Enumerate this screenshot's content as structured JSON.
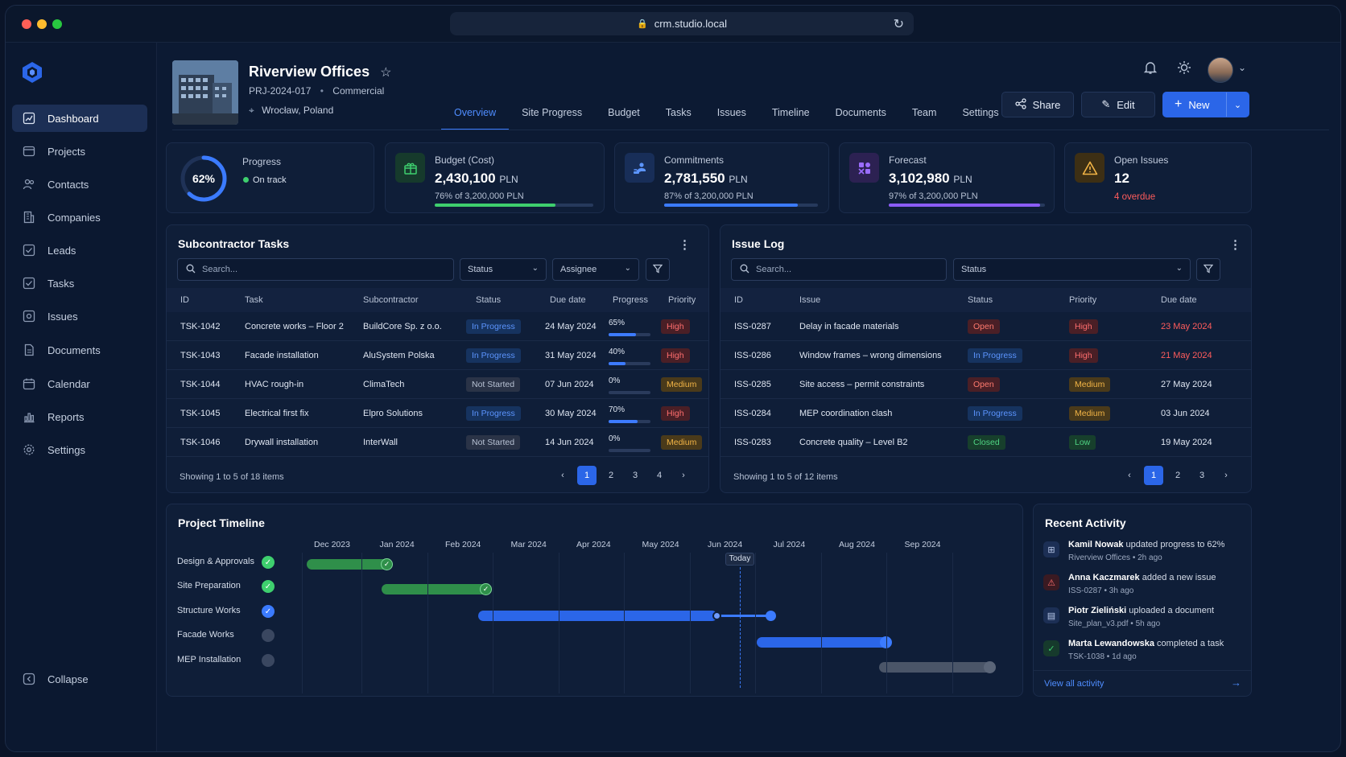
{
  "browser": {
    "url": "crm.studio.local"
  },
  "sidebar": {
    "items": [
      {
        "label": "Dashboard"
      },
      {
        "label": "Projects"
      },
      {
        "label": "Contacts"
      },
      {
        "label": "Companies"
      },
      {
        "label": "Leads"
      },
      {
        "label": "Tasks"
      },
      {
        "label": "Issues"
      },
      {
        "label": "Documents"
      },
      {
        "label": "Calendar"
      },
      {
        "label": "Reports"
      },
      {
        "label": "Settings"
      }
    ],
    "collapse_label": "Collapse"
  },
  "project": {
    "title": "Riverview Offices",
    "code": "PRJ-2024-017",
    "type": "Commercial",
    "location": "Wrocław, Poland"
  },
  "tabs": [
    "Overview",
    "Site Progress",
    "Budget",
    "Tasks",
    "Issues",
    "Timeline",
    "Documents",
    "Team",
    "Settings"
  ],
  "actions": {
    "share": "Share",
    "edit": "Edit",
    "new": "New"
  },
  "kpis": {
    "progress": {
      "label": "Progress",
      "value": "62%",
      "percent": 62,
      "status": "On track"
    },
    "budget": {
      "label": "Budget (Cost)",
      "value": "2,430,100",
      "unit": "PLN",
      "sub": "76% of 3,200,000 PLN",
      "percent": 76,
      "color": "#3ecf6e"
    },
    "commitments": {
      "label": "Commitments",
      "value": "2,781,550",
      "unit": "PLN",
      "sub": "87% of 3,200,000 PLN",
      "percent": 87,
      "color": "#3b7bff"
    },
    "forecast": {
      "label": "Forecast",
      "value": "3,102,980",
      "unit": "PLN",
      "sub": "97% of 3,200,000 PLN",
      "percent": 97,
      "color": "#8b5cf6"
    },
    "issues": {
      "label": "Open Issues",
      "value": "12",
      "sub": "4 overdue"
    }
  },
  "subcontractor_tasks": {
    "title": "Subcontractor Tasks",
    "search_placeholder": "Search...",
    "filters": [
      "Status",
      "Assignee"
    ],
    "columns": [
      "ID",
      "Task",
      "Subcontractor",
      "Status",
      "Due date",
      "Progress",
      "Priority"
    ],
    "rows": [
      {
        "id": "TSK-1042",
        "task": "Concrete works – Floor 2",
        "sub": "BuildCore Sp. z o.o.",
        "status": "In Progress",
        "due": "24 May 2024",
        "progress": "65%",
        "pct": 65,
        "priority": "High"
      },
      {
        "id": "TSK-1043",
        "task": "Facade installation",
        "sub": "AluSystem Polska",
        "status": "In Progress",
        "due": "31 May 2024",
        "progress": "40%",
        "pct": 40,
        "priority": "High"
      },
      {
        "id": "TSK-1044",
        "task": "HVAC rough-in",
        "sub": "ClimaTech",
        "status": "Not Started",
        "due": "07 Jun 2024",
        "progress": "0%",
        "pct": 0,
        "priority": "Medium"
      },
      {
        "id": "TSK-1045",
        "task": "Electrical first fix",
        "sub": "Elpro Solutions",
        "status": "In Progress",
        "due": "30 May 2024",
        "progress": "70%",
        "pct": 70,
        "priority": "High"
      },
      {
        "id": "TSK-1046",
        "task": "Drywall installation",
        "sub": "InterWall",
        "status": "Not Started",
        "due": "14 Jun 2024",
        "progress": "0%",
        "pct": 0,
        "priority": "Medium"
      }
    ],
    "footer": "Showing 1 to 5 of 18 items",
    "pages": [
      "1",
      "2",
      "3",
      "4"
    ]
  },
  "issue_log": {
    "title": "Issue Log",
    "search_placeholder": "Search...",
    "filter": "Status",
    "columns": [
      "ID",
      "Issue",
      "Status",
      "Priority",
      "Due date"
    ],
    "rows": [
      {
        "id": "ISS-0287",
        "issue": "Delay in facade materials",
        "status": "Open",
        "priority": "High",
        "due": "23 May 2024",
        "overdue": true
      },
      {
        "id": "ISS-0286",
        "issue": "Window frames – wrong dimensions",
        "status": "In Progress",
        "priority": "High",
        "due": "21 May 2024",
        "overdue": true
      },
      {
        "id": "ISS-0285",
        "issue": "Site access – permit constraints",
        "status": "Open",
        "priority": "Medium",
        "due": "27 May 2024",
        "overdue": false
      },
      {
        "id": "ISS-0284",
        "issue": "MEP coordination clash",
        "status": "In Progress",
        "priority": "Medium",
        "due": "03 Jun 2024",
        "overdue": false
      },
      {
        "id": "ISS-0283",
        "issue": "Concrete quality – Level B2",
        "status": "Closed",
        "priority": "Low",
        "due": "19 May 2024",
        "overdue": false
      }
    ],
    "footer": "Showing 1 to 5 of 12 items",
    "pages": [
      "1",
      "2",
      "3"
    ]
  },
  "timeline": {
    "title": "Project Timeline",
    "months": [
      "Dec 2023",
      "Jan 2024",
      "Feb 2024",
      "Mar 2024",
      "Apr 2024",
      "May 2024",
      "Jun 2024",
      "Jul 2024",
      "Aug 2024",
      "Sep 2024"
    ],
    "today_label": "Today",
    "phases": [
      {
        "label": "Design & Approvals",
        "state": "done"
      },
      {
        "label": "Site Preparation",
        "state": "done"
      },
      {
        "label": "Structure Works",
        "state": "active"
      },
      {
        "label": "Facade Works",
        "state": "pending"
      },
      {
        "label": "MEP Installation",
        "state": "pending"
      }
    ]
  },
  "activity": {
    "title": "Recent Activity",
    "items": [
      {
        "who": "Kamil Nowak",
        "what": "updated progress to 62%",
        "ref": "Riverview Offices",
        "when": "2h ago"
      },
      {
        "who": "Anna Kaczmarek",
        "what": "added a new issue",
        "ref": "ISS-0287",
        "when": "3h ago"
      },
      {
        "who": "Piotr Zieliński",
        "what": "uploaded a document",
        "ref": "Site_plan_v3.pdf",
        "when": "5h ago"
      },
      {
        "who": "Marta Lewandowska",
        "what": "completed a task",
        "ref": "TSK-1038",
        "when": "1d ago"
      }
    ],
    "view_all": "View all activity"
  },
  "colors": {
    "accent": "#2b66e8",
    "success": "#3ecf6e",
    "danger": "#ff5c5c",
    "warning": "#f2b446"
  }
}
